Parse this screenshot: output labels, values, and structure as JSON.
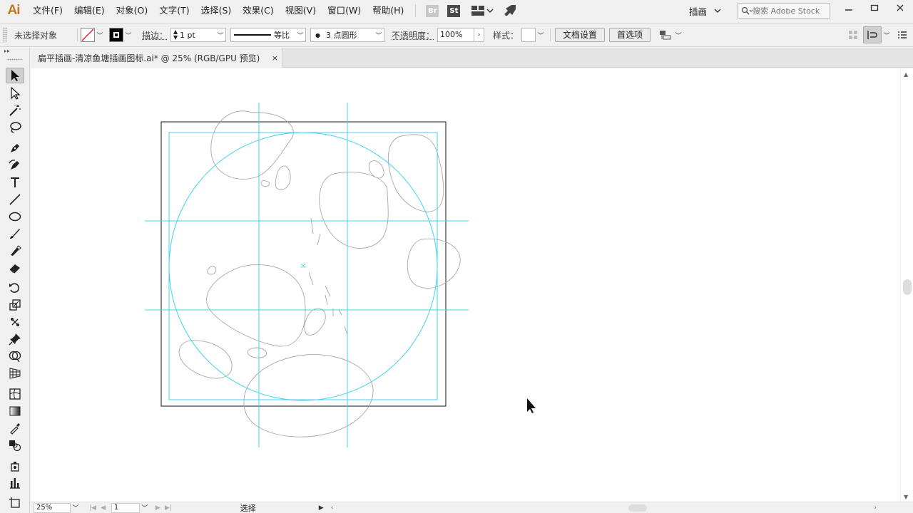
{
  "app": {
    "logo": "Ai",
    "menu": [
      "文件(F)",
      "编辑(E)",
      "对象(O)",
      "文字(T)",
      "选择(S)",
      "效果(C)",
      "视图(V)",
      "窗口(W)",
      "帮助(H)"
    ],
    "bridge_badge": "Br",
    "stock_badge": "St",
    "workspace": "插画",
    "search_placeholder": "搜索 Adobe Stock"
  },
  "control_bar": {
    "selection_status": "未选择对象",
    "stroke_label": "描边：",
    "stroke_weight": "1 pt",
    "profile_label": "等比",
    "brush_label": "3 点圆形",
    "opacity_label": "不透明度：",
    "opacity_value": "100%",
    "style_label": "样式：",
    "doc_setup_button": "文档设置",
    "prefs_button": "首选项"
  },
  "document_tab": {
    "title": "扁平插画-清凉鱼塘插画图标.ai* @ 25% (RGB/GPU 预览)",
    "close": "×"
  },
  "status_bar": {
    "zoom": "25%",
    "artboard": "1",
    "mode": "选择"
  },
  "colors": {
    "guide": "#3fd4ee",
    "artboard_border": "#000000",
    "path_outline": "#a8a8a8",
    "logo": "#c07a1c"
  }
}
